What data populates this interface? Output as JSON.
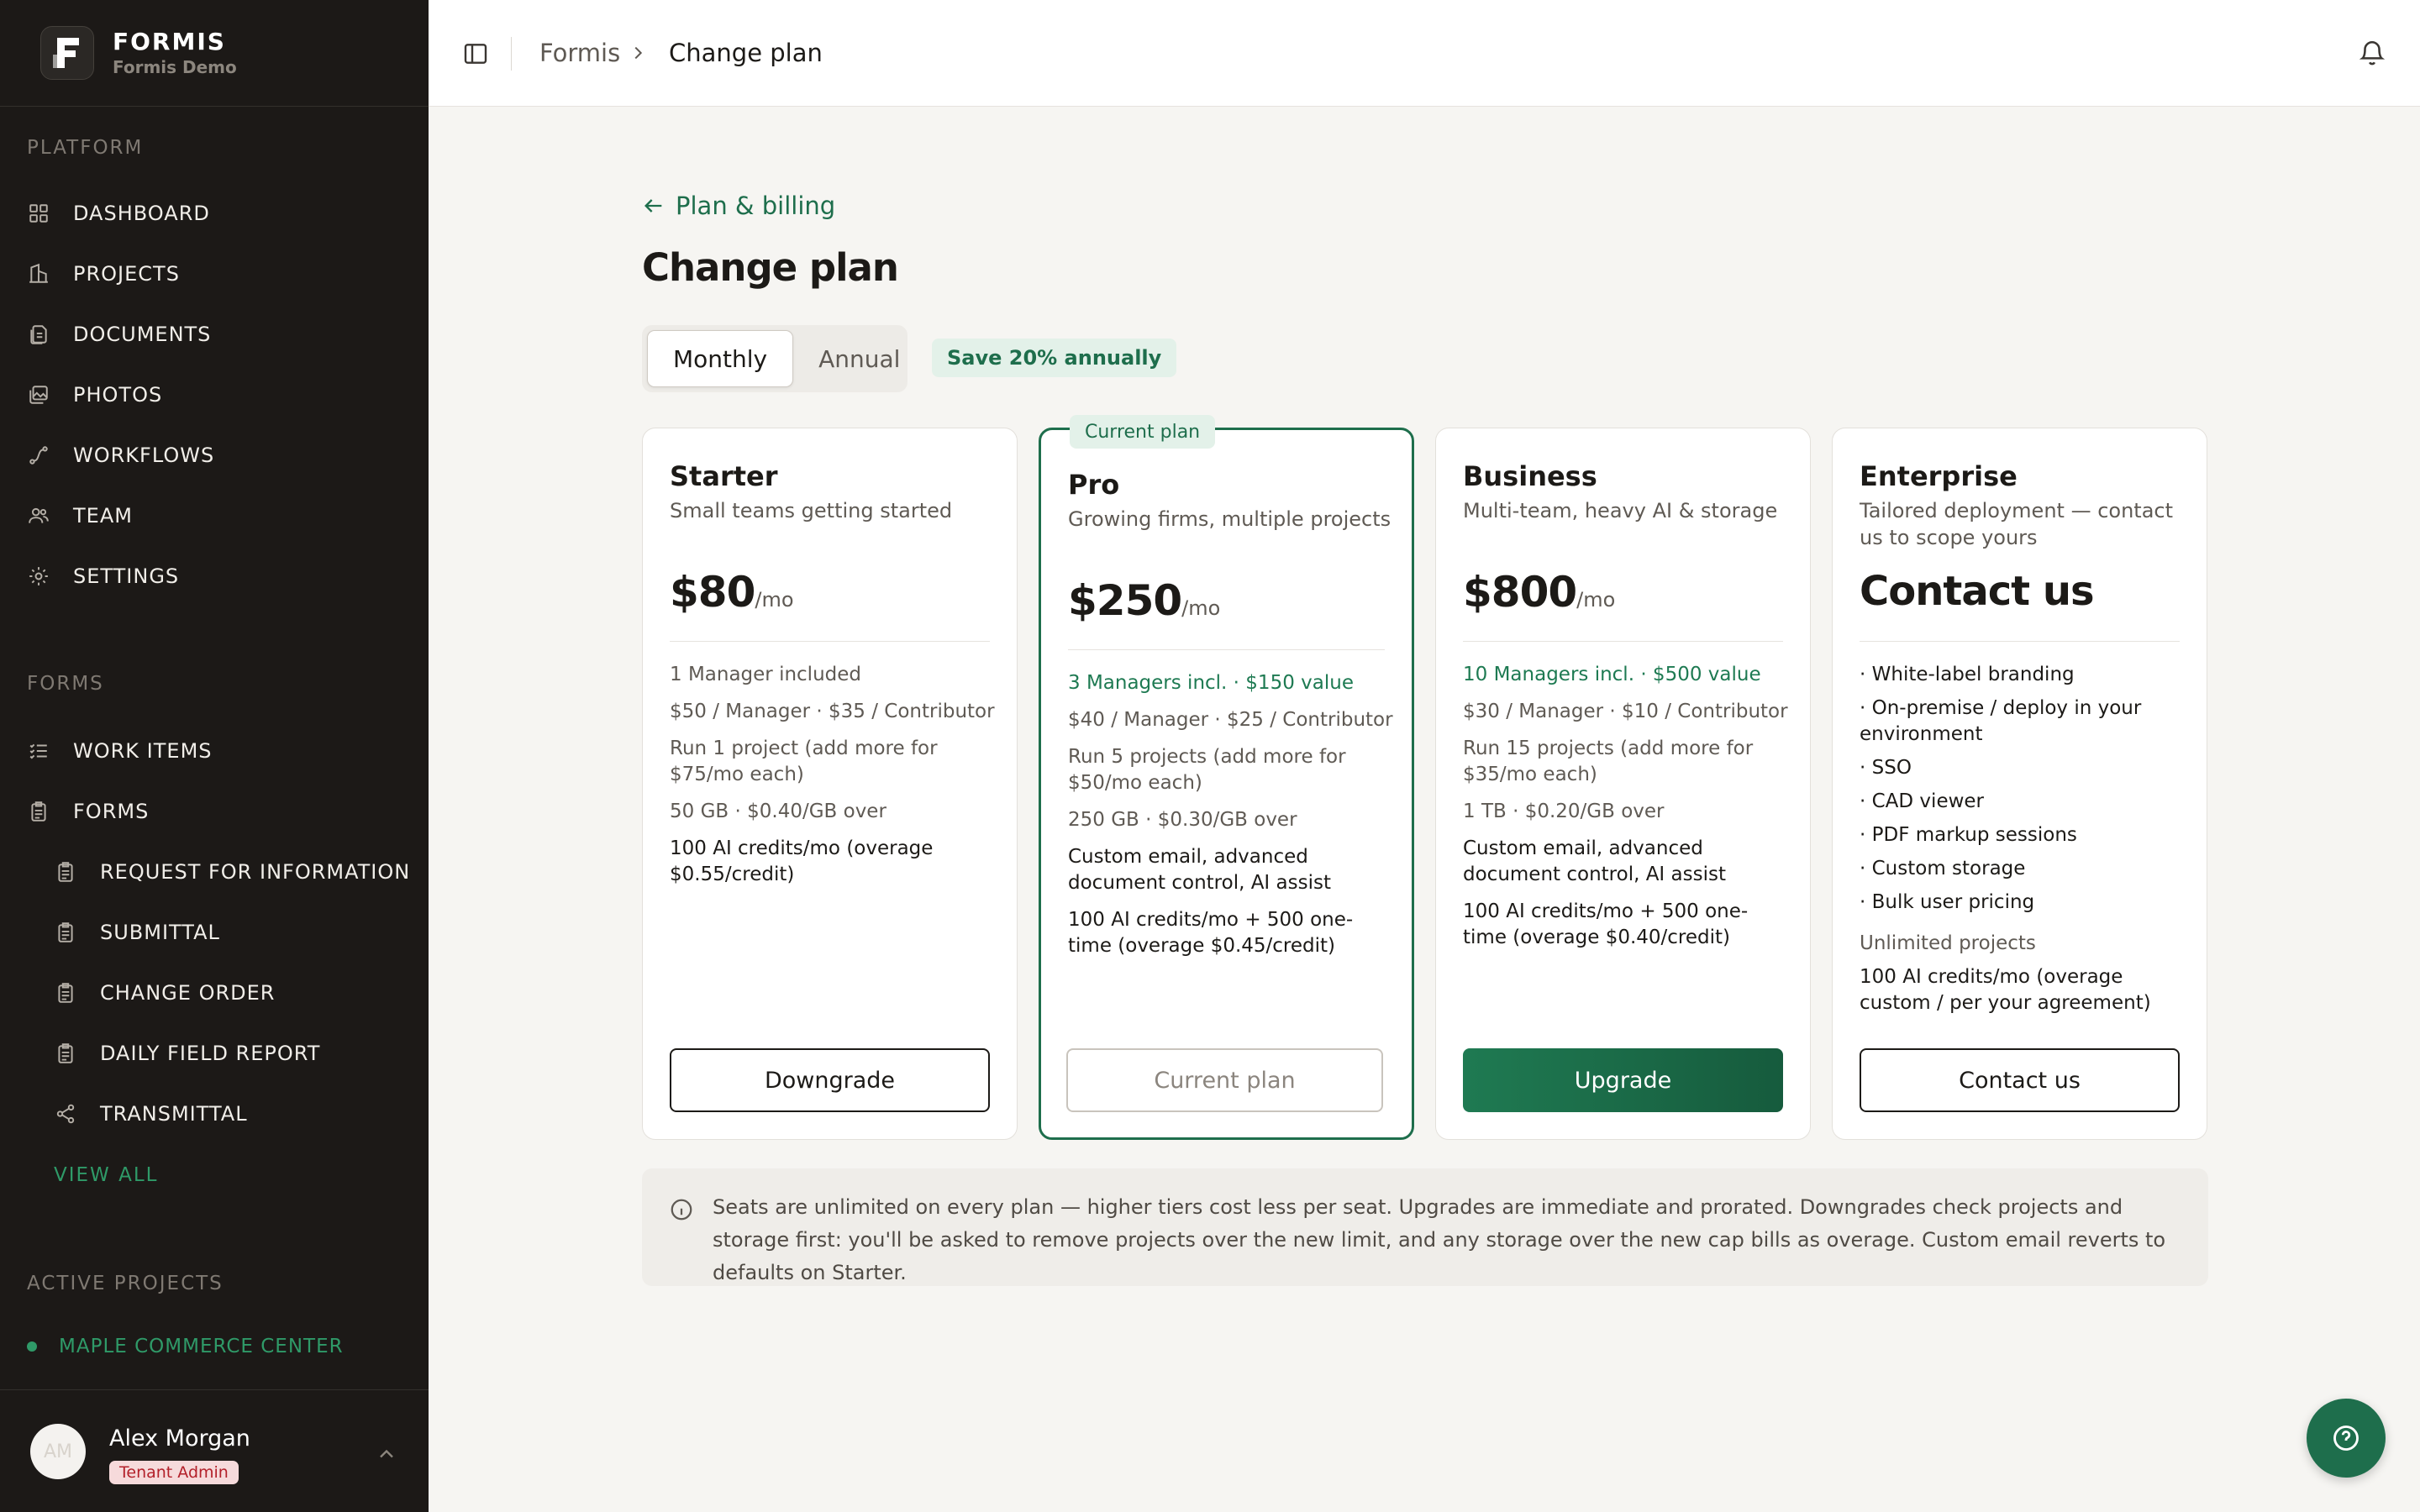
{
  "brand": {
    "name": "FORMIS",
    "subtitle": "Formis Demo"
  },
  "sidebar": {
    "platform_label": "PLATFORM",
    "platform_items": [
      {
        "label": "DASHBOARD",
        "icon": "grid-icon"
      },
      {
        "label": "PROJECTS",
        "icon": "building-icon"
      },
      {
        "label": "DOCUMENTS",
        "icon": "documents-icon"
      },
      {
        "label": "PHOTOS",
        "icon": "photos-icon"
      },
      {
        "label": "WORKFLOWS",
        "icon": "workflow-icon"
      },
      {
        "label": "TEAM",
        "icon": "team-icon"
      },
      {
        "label": "SETTINGS",
        "icon": "gear-icon"
      }
    ],
    "forms_label": "FORMS",
    "forms_items": [
      {
        "label": "WORK ITEMS",
        "icon": "checklist-icon"
      },
      {
        "label": "FORMS",
        "icon": "clipboard-icon"
      }
    ],
    "form_types": [
      {
        "label": "REQUEST FOR INFORMATION",
        "icon": "clipboard-icon"
      },
      {
        "label": "SUBMITTAL",
        "icon": "clipboard-icon"
      },
      {
        "label": "CHANGE ORDER",
        "icon": "clipboard-icon"
      },
      {
        "label": "DAILY FIELD REPORT",
        "icon": "clipboard-icon"
      },
      {
        "label": "TRANSMITTAL",
        "icon": "share-icon"
      }
    ],
    "view_all": "VIEW ALL",
    "active_projects_label": "ACTIVE PROJECTS",
    "active_projects": [
      {
        "label": "MAPLE COMMERCE CENTER"
      }
    ]
  },
  "user": {
    "initials": "AM",
    "name": "Alex Morgan",
    "role": "Tenant Admin"
  },
  "breadcrumb": {
    "root": "Formis",
    "current": "Change plan"
  },
  "main": {
    "back_link": "Plan & billing",
    "title": "Change plan",
    "billing_toggle": {
      "monthly": "Monthly",
      "annual": "Annual",
      "selected": "Monthly"
    },
    "save_badge": "Save 20% annually",
    "plans": [
      {
        "name": "Starter",
        "description": "Small teams getting started",
        "price": "$80",
        "period": "/mo",
        "features": [
          "1 Manager included",
          "$50 / Manager · $35 / Contributor",
          "Run 1 project (add more for $75/mo each)",
          "50 GB · $0.40/GB over",
          "100 AI credits/mo (overage $0.55/credit)"
        ],
        "button": "Downgrade"
      },
      {
        "name": "Pro",
        "tag": "Current plan",
        "description": "Growing firms, multiple projects",
        "price": "$250",
        "period": "/mo",
        "features": [
          "3 Managers incl. · $150 value",
          "$40 / Manager · $25 / Contributor",
          "Run 5 projects (add more for $50/mo each)",
          "250 GB · $0.30/GB over",
          "Custom email, advanced document control, AI assist",
          "100 AI credits/mo + 500 one-time (overage $0.45/credit)"
        ],
        "button": "Current plan"
      },
      {
        "name": "Business",
        "description": "Multi-team, heavy AI & storage",
        "price": "$800",
        "period": "/mo",
        "features": [
          "10 Managers incl. · $500 value",
          "$30 / Manager · $10 / Contributor",
          "Run 15 projects (add more for $35/mo each)",
          "1 TB · $0.20/GB over",
          "Custom email, advanced document control, AI assist",
          "100 AI credits/mo + 500 one-time (overage $0.40/credit)"
        ],
        "button": "Upgrade"
      },
      {
        "name": "Enterprise",
        "description": "Tailored deployment — contact us to scope yours",
        "price": "Contact us",
        "features": [
          "· White-label branding",
          "· On-premise / deploy in your environment",
          "· SSO",
          "· CAD viewer",
          "· PDF markup sessions",
          "· Custom storage",
          "· Bulk user pricing",
          "Unlimited projects",
          "100 AI credits/mo (overage custom / per your agreement)"
        ],
        "button": "Contact us"
      }
    ],
    "info_note": "Seats are unlimited on every plan — higher tiers cost less per seat. Upgrades are immediate and prorated. Downgrades check projects and storage first: you'll be asked to remove projects over the new limit, and any storage over the new cap bills as overage. Custom email reverts to defaults on Starter."
  },
  "colors": {
    "accent": "#1e6e4c",
    "sidebar_bg": "#1c1917",
    "page_bg": "#f6f5f2",
    "badge_red": "#b3202a"
  }
}
